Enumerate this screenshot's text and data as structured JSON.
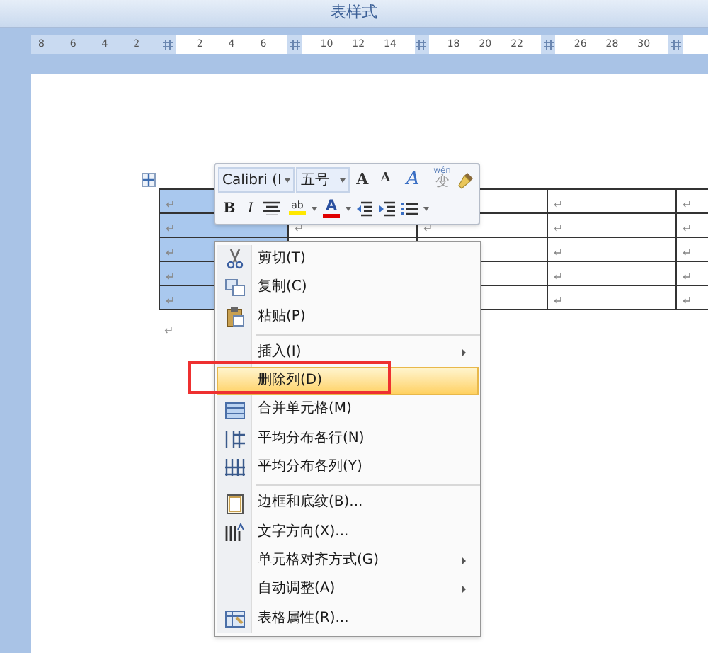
{
  "window": {
    "title": "表样式"
  },
  "ruler": [
    {
      "kind": "number",
      "label": "8"
    },
    {
      "kind": "number",
      "label": "6"
    },
    {
      "kind": "number",
      "label": "4"
    },
    {
      "kind": "number",
      "label": "2"
    },
    {
      "kind": "marker"
    },
    {
      "kind": "number",
      "label": "2"
    },
    {
      "kind": "number",
      "label": "4"
    },
    {
      "kind": "number",
      "label": "6"
    },
    {
      "kind": "marker"
    },
    {
      "kind": "number",
      "label": "10"
    },
    {
      "kind": "number",
      "label": "12"
    },
    {
      "kind": "number",
      "label": "14"
    },
    {
      "kind": "marker"
    },
    {
      "kind": "number",
      "label": "18"
    },
    {
      "kind": "number",
      "label": "20"
    },
    {
      "kind": "number",
      "label": "22"
    },
    {
      "kind": "marker"
    },
    {
      "kind": "number",
      "label": "26"
    },
    {
      "kind": "number",
      "label": "28"
    },
    {
      "kind": "number",
      "label": "30"
    },
    {
      "kind": "marker"
    }
  ],
  "table": {
    "columns": [
      {
        "selected": true
      },
      {
        "selected": false
      },
      {
        "selected": false
      },
      {
        "selected": false
      },
      {
        "selected": false
      }
    ],
    "rows": [
      {
        "cells": [
          "↵",
          null,
          null,
          "↵",
          "↵"
        ]
      },
      {
        "cells": [
          "↵",
          "↵",
          "↵",
          "↵",
          "↵"
        ]
      },
      {
        "cells": [
          "↵",
          null,
          null,
          "↵",
          "↵"
        ]
      },
      {
        "cells": [
          "↵",
          null,
          null,
          "↵",
          "↵"
        ]
      },
      {
        "cells": [
          "↵",
          null,
          null,
          "↵",
          "↵"
        ]
      }
    ],
    "after_mark": "↵"
  },
  "mini_toolbar": {
    "font": "Calibri (Ⅰ",
    "size": "五号",
    "grow": "A",
    "shrink": "A",
    "styles": "A",
    "phonetic_top": "wén",
    "phonetic_bottom": "变",
    "bold": "B",
    "italic": "I",
    "highlight": "ab",
    "font_color": "A"
  },
  "context_menu": [
    {
      "kind": "item",
      "label": "剪切(T)",
      "submenu": false,
      "selected": false
    },
    {
      "kind": "item",
      "label": "复制(C)",
      "submenu": false,
      "selected": false
    },
    {
      "kind": "item",
      "label": "粘贴(P)",
      "submenu": false,
      "selected": false
    },
    {
      "kind": "separator"
    },
    {
      "kind": "item",
      "label": "插入(I)",
      "submenu": true,
      "selected": false
    },
    {
      "kind": "item",
      "label": "删除列(D)",
      "submenu": false,
      "selected": true
    },
    {
      "kind": "item",
      "label": "合并单元格(M)",
      "submenu": false,
      "selected": false
    },
    {
      "kind": "item",
      "label": "平均分布各行(N)",
      "submenu": false,
      "selected": false
    },
    {
      "kind": "item",
      "label": "平均分布各列(Y)",
      "submenu": false,
      "selected": false
    },
    {
      "kind": "separator"
    },
    {
      "kind": "item",
      "label": "边框和底纹(B)...",
      "submenu": false,
      "selected": false
    },
    {
      "kind": "item",
      "label": "文字方向(X)...",
      "submenu": false,
      "selected": false
    },
    {
      "kind": "item",
      "label": "单元格对齐方式(G)",
      "submenu": true,
      "selected": false
    },
    {
      "kind": "item",
      "label": "自动调整(A)",
      "submenu": true,
      "selected": false
    },
    {
      "kind": "item",
      "label": "表格属性(R)...",
      "submenu": false,
      "selected": false
    }
  ]
}
